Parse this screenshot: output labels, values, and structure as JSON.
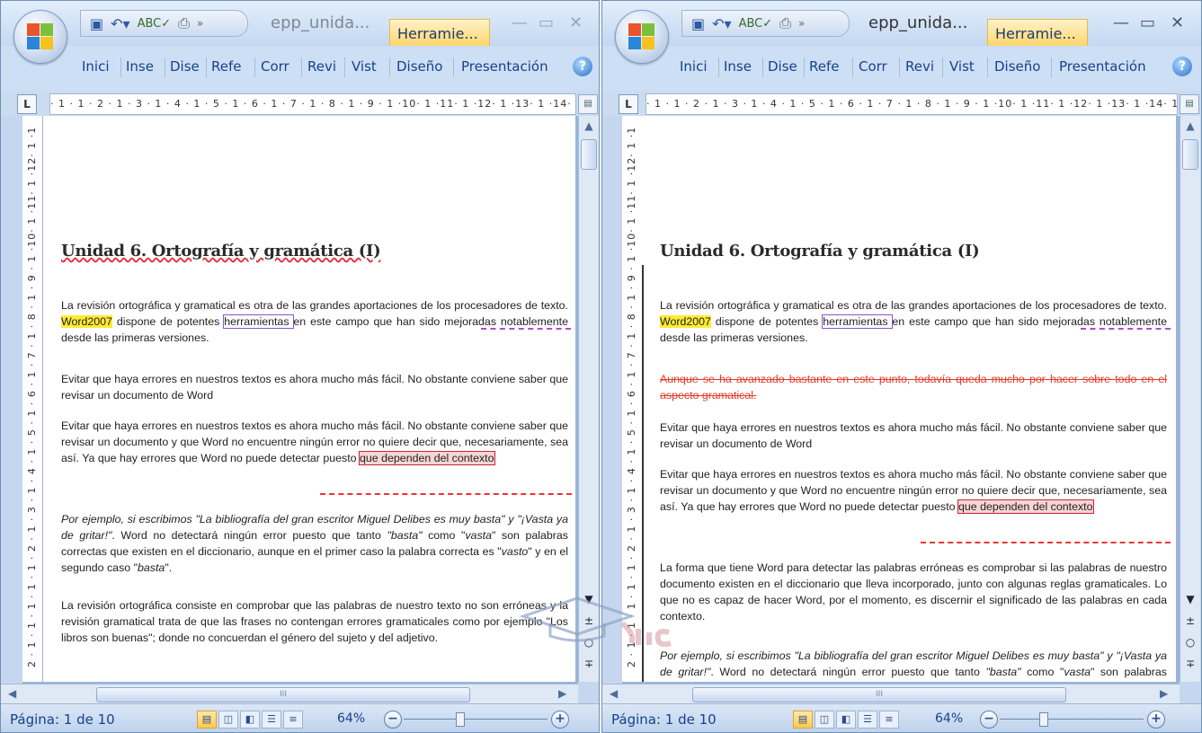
{
  "app": {
    "title": "epp_unida...",
    "contextual_tab": "Herramie...",
    "qat_items": [
      "save-icon",
      "undo-icon",
      "spelling-icon",
      "print-preview-icon"
    ],
    "ribbon_tabs": [
      "Inici",
      "Inse",
      "Dise",
      "Refe",
      "Corr",
      "Revi",
      "Vist",
      "Diseño",
      "Presentación"
    ]
  },
  "ruler": {
    "horizontal": "· 1 · 1 · 2 · 1 · 3 · 1 · 4 · 1 · 5 · 1 · 6 · 1 · 7 · 1 · 8 · 1 · 9 · 1 ·10· 1 ·11· 1 ·12· 1 ·13· 1 ·14· 1",
    "vertical": "2 · 1 · 1 · 1 · 1 · 1 · 2 · 1 · 3 · 1 · 4 · 1 · 5 · 1 · 6 · 1 · 7 · 1 · 8 · 1 · 9 · 1 ·10· 1 ·11· 1 ·12· 1 ·13"
  },
  "document": {
    "heading": "Unidad 6. Ortografía y gramática (I)",
    "p1": {
      "before": "La revisión ortográfica y gramatical es otra de las grandes aportaciones de los procesadores de texto. ",
      "highlight": "Word2007",
      "mid": " dispone de potentes ",
      "purple": "herramientas ",
      "after": "en este campo que han sido mejoradas notablemente  desde las primeras versiones."
    },
    "deleted": "Aunque se ha avanzado bastante en este punto, todavía queda mucho por hacer sobre todo en el aspecto gramatical.",
    "p2": "Evitar que haya errores en nuestros textos es ahora mucho más fácil. No obstante conviene saber que revisar un documento  de Word",
    "p3": {
      "before": "Evitar que haya errores en nuestros textos es ahora mucho más fácil. No obstante conviene saber que revisar un documento y que Word no encuentre ningún error no quiere decir que, necesariamente, sea así. Ya que hay errores que Word no puede detectar puesto ",
      "marked": "que dependen del contexto"
    },
    "p_inserted": "La forma que tiene Word para detectar las palabras erróneas es comprobar si las palabras de nuestro documento existen en el diccionario que lleva incorporado, junto con algunas reglas gramaticales. Lo que no es capaz de hacer Word, por el momento, es discernir el significado  de las palabras en cada contexto.",
    "p4": {
      "t1": "Por ejemplo, si escribimos ",
      "q1": "\"La bibliografía del gran escritor Miguel Delibes es muy basta\"",
      "t2": " y ",
      "q2": "\"¡Vasta ya de gritar!\"",
      "t3": ". Word no detectará ningún error puesto que tanto ",
      "w1": "\"basta\"",
      "t4": " como \"",
      "w2": "vasta",
      "t5": "\" son palabras correctas que existen en el diccionario, aunque en el primer caso la palabra correcta es \"",
      "w3": "vasto",
      "t6": "\" y en el segundo caso \"",
      "w4": "basta",
      "t7": "\"."
    },
    "p5": "La revisión ortográfica consiste en comprobar que las palabras de nuestro texto no son erróneas y la revisión gramatical trata de que las frases no contengan errores gramaticales como por ejemplo \"Los libros son buenas\"; donde no concuerdan el género del sujeto y del adjetivo."
  },
  "status": {
    "page": "Página: 1 de 10",
    "zoom": "64%",
    "scroll_thumb": "III"
  },
  "colors": {
    "accent": "#15428b",
    "highlight": "#ffeb33",
    "deleted_text": "#e43a2a"
  }
}
